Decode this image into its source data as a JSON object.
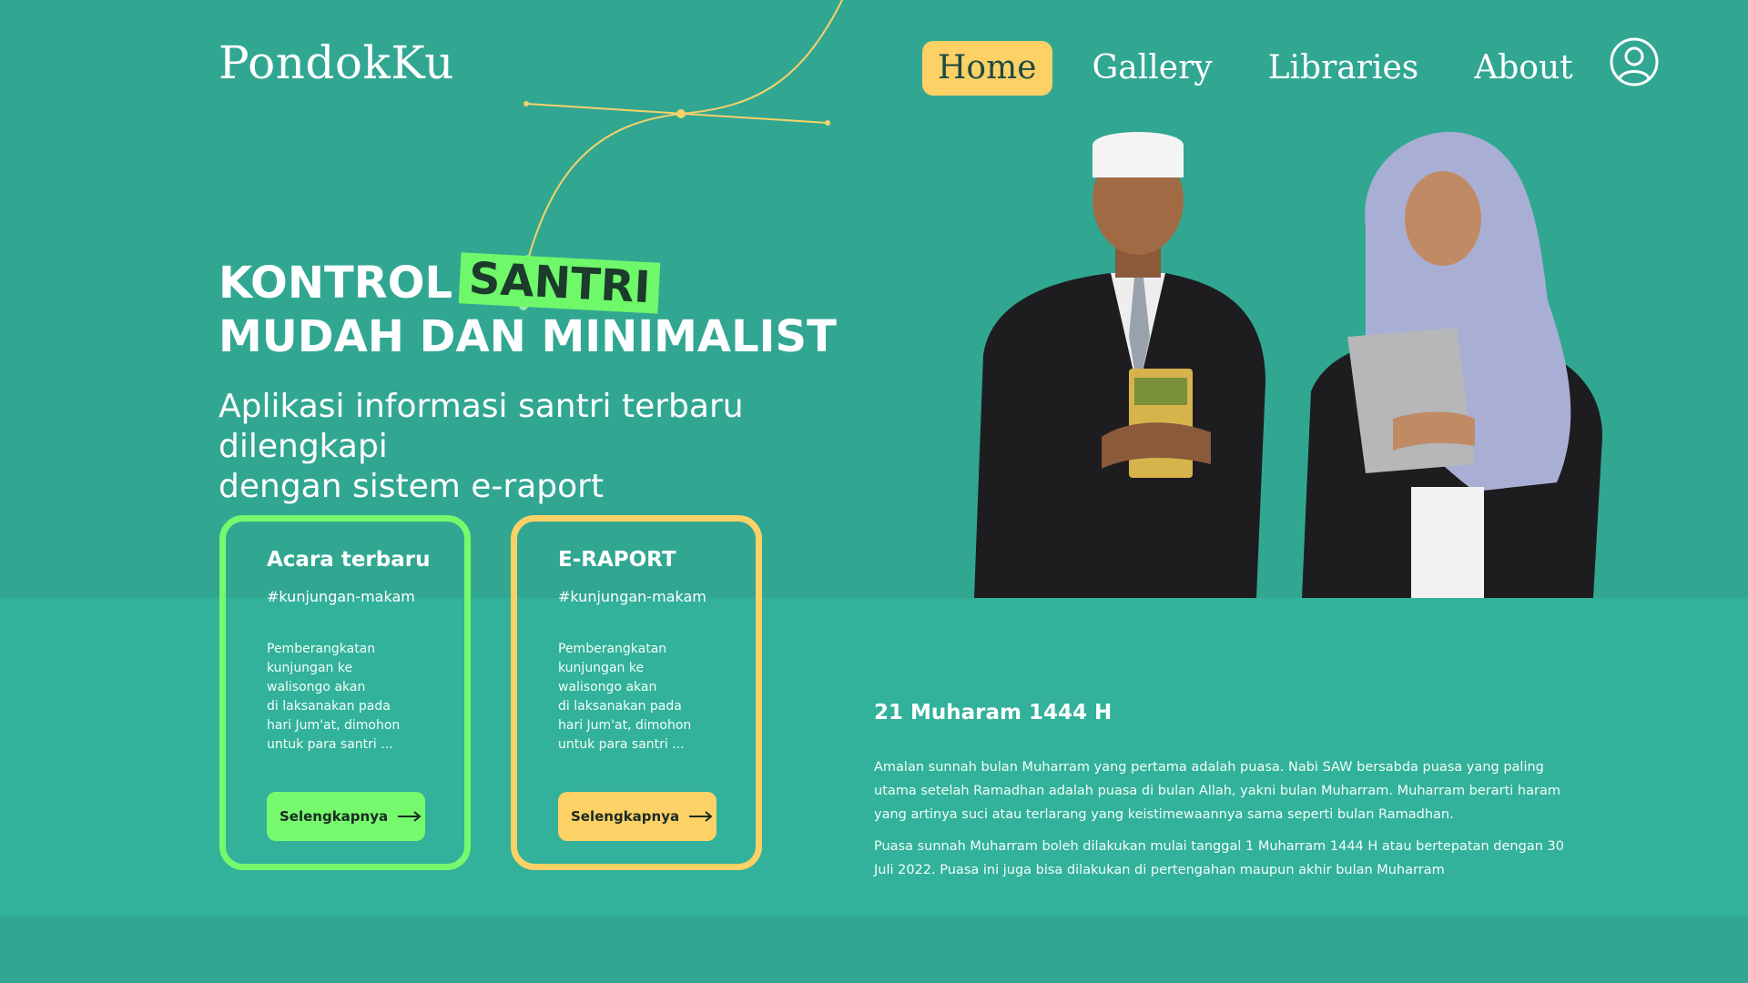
{
  "brand": "PondokKu",
  "nav": {
    "items": [
      "Home",
      "Gallery",
      "Libraries",
      "About"
    ],
    "active": "Home"
  },
  "profile_icon": "user-circle-icon",
  "hero": {
    "title_prefix": "KONTROL",
    "title_highlight": "SANTRI",
    "title_line2": "MUDAH DAN MINIMALIST",
    "subtitle_line1": "Aplikasi informasi santri terbaru dilengkapi",
    "subtitle_line2": "dengan sistem e-raport"
  },
  "cards": [
    {
      "title": "Acara terbaru",
      "tag": "#kunjungan-makam",
      "body": [
        "Pemberangkatan",
        "kunjungan ke",
        "walisongo akan",
        "di laksanakan pada",
        "hari Jum'at, dimohon",
        "untuk para santri ..."
      ],
      "button": "Selengkapnya",
      "color": "#76f96d"
    },
    {
      "title": "E-RAPORT",
      "tag": "#kunjungan-makam",
      "body": [
        "Pemberangkatan",
        "kunjungan ke",
        "walisongo akan",
        "di laksanakan pada",
        "hari Jum'at, dimohon",
        "untuk para santri ..."
      ],
      "button": "Selengkapnya",
      "color": "#fdd166"
    }
  ],
  "news": {
    "date": "21 Muharam 1444 H",
    "paragraphs": [
      "Amalan sunnah bulan Muharram yang pertama adalah puasa. Nabi SAW bersabda puasa yang paling utama setelah Ramadhan adalah puasa di bulan Allah, yakni bulan Muharram. Muharram berarti haram yang artinya suci atau terlarang yang keistimewaannya sama seperti bulan Ramadhan.",
      "Puasa sunnah Muharram boleh dilakukan mulai tanggal 1 Muharram 1444 H atau bertepatan dengan 30 Juli 2022. Puasa ini juga bisa dilakukan di pertengahan maupun akhir bulan Muharram"
    ]
  },
  "colors": {
    "background": "#31a792",
    "band": "#32b19b",
    "green_accent": "#76f96d",
    "yellow_accent": "#fdd166"
  }
}
